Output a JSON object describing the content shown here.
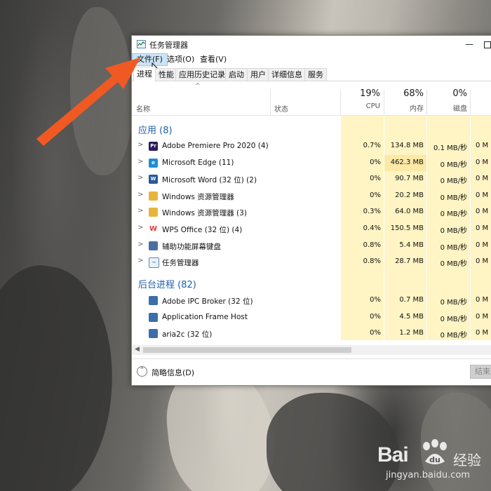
{
  "window": {
    "title": "任务管理器",
    "minimize_glyph": "—"
  },
  "menu": [
    {
      "label": "文件(F)"
    },
    {
      "label": "选项(O)"
    },
    {
      "label": "查看(V)"
    }
  ],
  "tabs": [
    {
      "label": "进程"
    },
    {
      "label": "性能"
    },
    {
      "label": "应用历史记录"
    },
    {
      "label": "启动"
    },
    {
      "label": "用户"
    },
    {
      "label": "详细信息"
    },
    {
      "label": "服务"
    }
  ],
  "columns": {
    "name": "名称",
    "status": "状态",
    "cpu": {
      "pct": "19%",
      "label": "CPU"
    },
    "memory": {
      "pct": "68%",
      "label": "内存"
    },
    "disk": {
      "pct": "0%",
      "label": "磁盘"
    }
  },
  "groups": {
    "apps": {
      "title": "应用 (8)"
    },
    "background": {
      "title": "后台进程 (82)"
    }
  },
  "apps": [
    {
      "name": "Adobe Premiere Pro 2020 (4)",
      "icon": "premiere-icon",
      "cpu": "0.7%",
      "mem": "134.8 MB",
      "disk": "0.1 MB/秒",
      "net": "0 M"
    },
    {
      "name": "Microsoft Edge (11)",
      "icon": "edge-icon",
      "cpu": "0%",
      "mem": "462.3 MB",
      "disk": "0 MB/秒",
      "net": "0 M"
    },
    {
      "name": "Microsoft Word (32 位) (2)",
      "icon": "word-icon",
      "cpu": "0%",
      "mem": "90.7 MB",
      "disk": "0 MB/秒",
      "net": "0 M"
    },
    {
      "name": "Windows 资源管理器",
      "icon": "folder-icon",
      "cpu": "0%",
      "mem": "20.2 MB",
      "disk": "0 MB/秒",
      "net": "0 M"
    },
    {
      "name": "Windows 资源管理器 (3)",
      "icon": "folder-icon",
      "cpu": "0.3%",
      "mem": "64.0 MB",
      "disk": "0 MB/秒",
      "net": "0 M"
    },
    {
      "name": "WPS Office (32 位) (4)",
      "icon": "wps-icon",
      "cpu": "0.4%",
      "mem": "150.5 MB",
      "disk": "0 MB/秒",
      "net": "0 M"
    },
    {
      "name": "辅助功能屏幕键盘",
      "icon": "keyboard-icon",
      "cpu": "0.8%",
      "mem": "5.4 MB",
      "disk": "0 MB/秒",
      "net": "0 M"
    },
    {
      "name": "任务管理器",
      "icon": "task-manager-icon",
      "cpu": "0.8%",
      "mem": "28.7 MB",
      "disk": "0 MB/秒",
      "net": "0 M"
    }
  ],
  "background": [
    {
      "name": "Adobe IPC Broker (32 位)",
      "icon": "app-window-icon",
      "cpu": "0%",
      "mem": "0.7 MB",
      "disk": "0 MB/秒",
      "net": "0 M"
    },
    {
      "name": "Application Frame Host",
      "icon": "app-window-icon",
      "cpu": "0%",
      "mem": "4.5 MB",
      "disk": "0 MB/秒",
      "net": "0 M"
    },
    {
      "name": "aria2c (32 位)",
      "icon": "app-window-icon",
      "cpu": "0%",
      "mem": "1.2 MB",
      "disk": "0 MB/秒",
      "net": "0 M"
    }
  ],
  "footer": {
    "fewer_details": "简略信息(D)",
    "end_task": "结束"
  },
  "watermark": {
    "brand": "Bai",
    "brand_cn": "经验",
    "url": "jingyan.baidu.com"
  },
  "colors": {
    "arrow": "#f05a22",
    "group_title": "#1f5fa8",
    "cpu_shade": "#fff4c4",
    "mem_shade": "#fde9a6"
  }
}
